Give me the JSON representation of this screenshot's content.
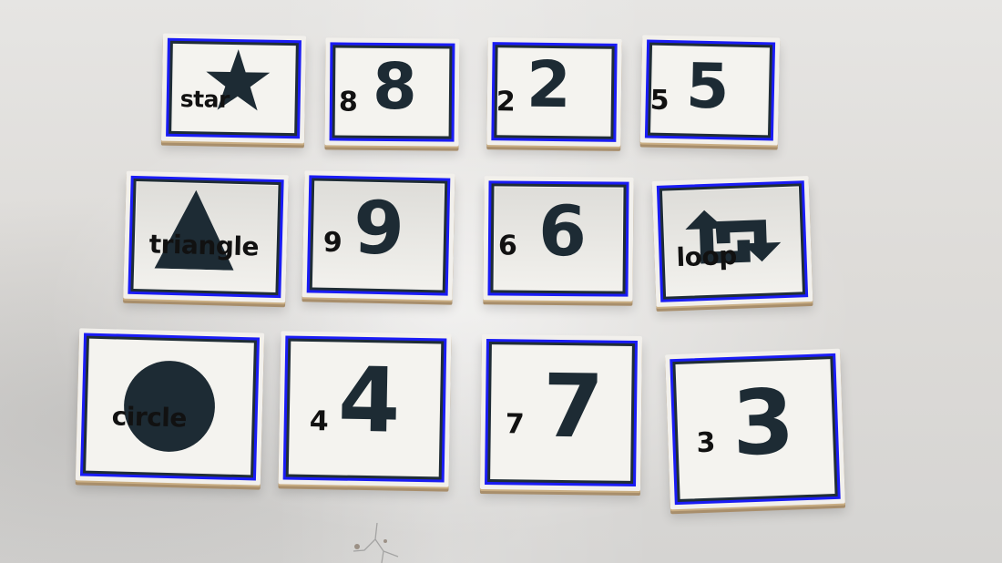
{
  "scene": {
    "background_color": "#dedcd9",
    "outline_colors": {
      "detection_box": "#1a1cf5",
      "card_border": "#1f2d36",
      "card_edge": "#c9ae84"
    }
  },
  "tiles": [
    {
      "id": "star",
      "kind": "shape",
      "icon": "star-icon",
      "label": "star"
    },
    {
      "id": "8",
      "kind": "number",
      "value": "8",
      "label": "8"
    },
    {
      "id": "2",
      "kind": "number",
      "value": "2",
      "label": "2"
    },
    {
      "id": "5",
      "kind": "number",
      "value": "5",
      "label": "5"
    },
    {
      "id": "triangle",
      "kind": "shape",
      "icon": "triangle-icon",
      "label": "triangle"
    },
    {
      "id": "9",
      "kind": "number",
      "value": "9",
      "label": "9"
    },
    {
      "id": "6",
      "kind": "number",
      "value": "6",
      "label": "6"
    },
    {
      "id": "loop",
      "kind": "shape",
      "icon": "loop-icon",
      "label": "loop"
    },
    {
      "id": "circle",
      "kind": "shape",
      "icon": "circle-icon",
      "label": "circle"
    },
    {
      "id": "4",
      "kind": "number",
      "value": "4",
      "label": "4"
    },
    {
      "id": "7",
      "kind": "number",
      "value": "7",
      "label": "7"
    },
    {
      "id": "3",
      "kind": "number",
      "value": "3",
      "label": "3"
    }
  ]
}
